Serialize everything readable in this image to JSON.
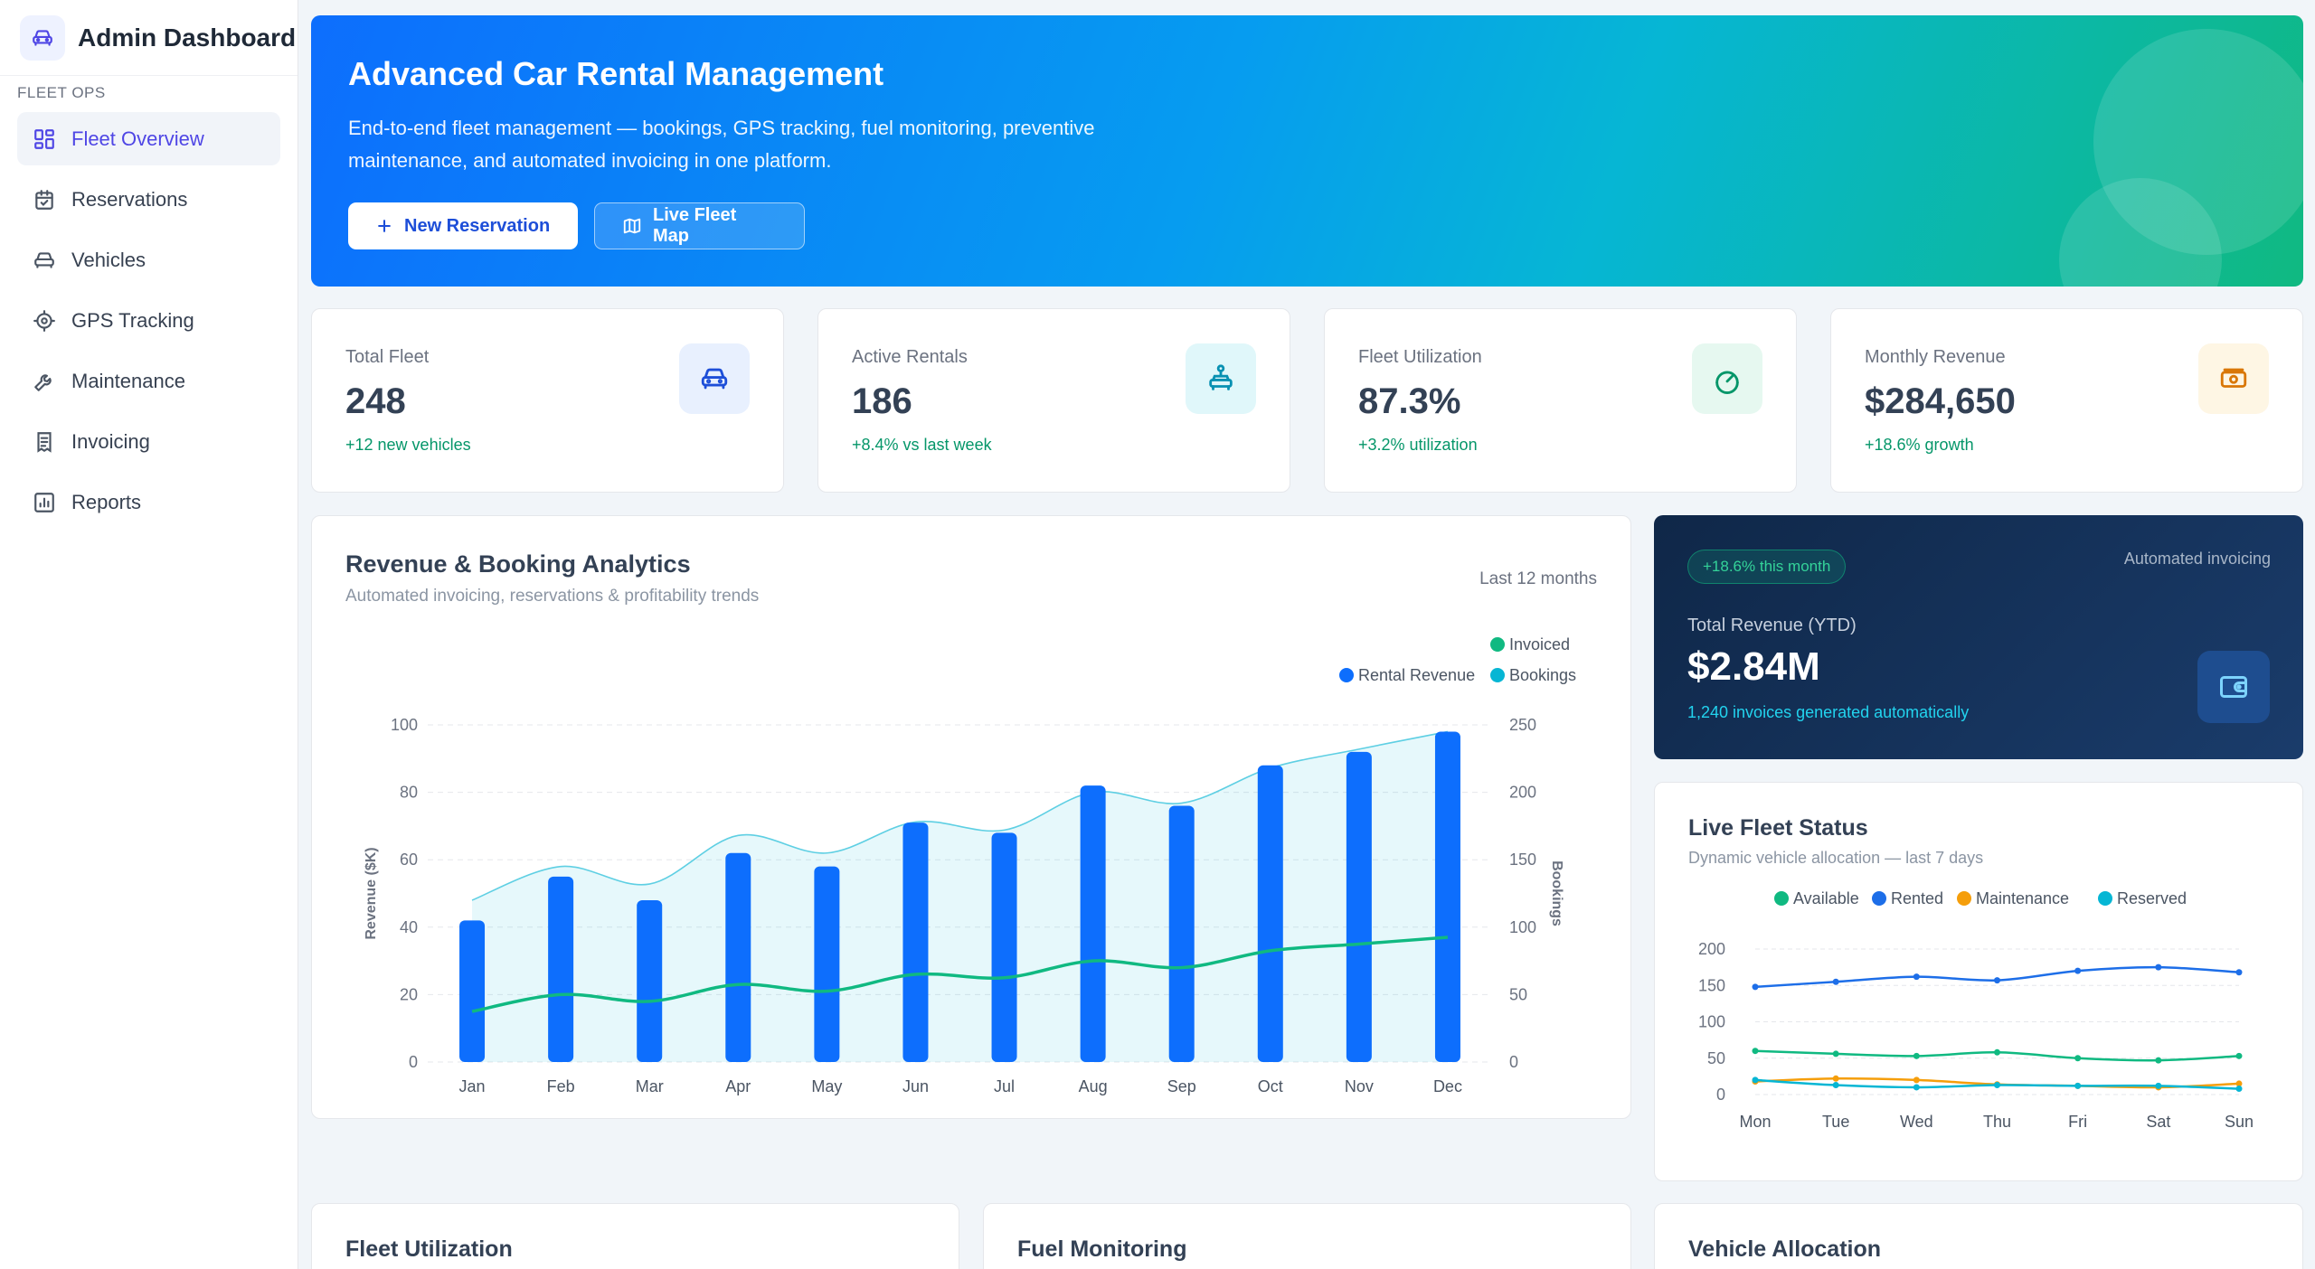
{
  "app": {
    "title": "Admin Dashboard"
  },
  "sidebar": {
    "section": "FLEET OPS",
    "items": [
      {
        "label": "Fleet Overview",
        "icon": "grid-icon",
        "active": true
      },
      {
        "label": "Reservations",
        "icon": "calendar-check-icon"
      },
      {
        "label": "Vehicles",
        "icon": "car-icon"
      },
      {
        "label": "GPS Tracking",
        "icon": "crosshair-icon"
      },
      {
        "label": "Maintenance",
        "icon": "wrench-icon"
      },
      {
        "label": "Invoicing",
        "icon": "receipt-icon"
      },
      {
        "label": "Reports",
        "icon": "bar-chart-icon"
      }
    ]
  },
  "hero": {
    "title": "Advanced Car Rental Management",
    "description": "End-to-end fleet management — bookings, GPS tracking, fuel monitoring, preventive maintenance, and automated invoicing in one platform.",
    "primary_button": "New Reservation",
    "secondary_button": "Live Fleet Map"
  },
  "stats": [
    {
      "label": "Total Fleet",
      "value": "248",
      "change": "+12 new vehicles",
      "icon": "car-icon",
      "color": "#1d4ed8",
      "bg": "#e8f0fe"
    },
    {
      "label": "Active Rentals",
      "value": "186",
      "change": "+8.4% vs last week",
      "icon": "car-key-icon",
      "color": "#0891b2",
      "bg": "#e0f7fa"
    },
    {
      "label": "Fleet Utilization",
      "value": "87.3%",
      "change": "+3.2% utilization",
      "icon": "gauge-icon",
      "color": "#059669",
      "bg": "#e6f8f0"
    },
    {
      "label": "Monthly Revenue",
      "value": "$284,650",
      "change": "+18.6% growth",
      "icon": "cash-icon",
      "color": "#d97706",
      "bg": "#fef6e4"
    }
  ],
  "analytics": {
    "title": "Revenue & Booking Analytics",
    "subtitle": "Automated invoicing, reservations & profitability trends",
    "range": "Last 12 months"
  },
  "revenue_card": {
    "badge": "+18.6% this month",
    "tag": "Automated invoicing",
    "label": "Total Revenue (YTD)",
    "value": "$2.84M",
    "note": "1,240 invoices generated automatically"
  },
  "live_fleet": {
    "title": "Live Fleet Status",
    "subtitle": "Dynamic vehicle allocation — last 7 days"
  },
  "bottom_cards": [
    "Fleet Utilization",
    "Fuel Monitoring",
    "Vehicle Allocation"
  ],
  "chart_data": [
    {
      "type": "bar",
      "categories": [
        "Jan",
        "Feb",
        "Mar",
        "Apr",
        "May",
        "Jun",
        "Jul",
        "Aug",
        "Sep",
        "Oct",
        "Nov",
        "Dec"
      ],
      "series": [
        {
          "name": "Rental Revenue",
          "type": "bar",
          "axis": "left",
          "color": "#0d6efd",
          "values": [
            42,
            55,
            48,
            62,
            58,
            71,
            68,
            82,
            76,
            88,
            92,
            98
          ]
        },
        {
          "name": "Invoiced",
          "type": "line",
          "axis": "left",
          "color": "#10b981",
          "values": [
            15,
            20,
            18,
            23,
            21,
            26,
            25,
            30,
            28,
            33,
            35,
            37
          ]
        },
        {
          "name": "Bookings",
          "type": "area",
          "axis": "right",
          "color": "#06b6d4",
          "values": [
            120,
            145,
            132,
            168,
            155,
            178,
            172,
            200,
            192,
            218,
            232,
            245
          ]
        }
      ],
      "ylabel": "Revenue ($K)",
      "y2label": "Bookings",
      "ylim": [
        0,
        100
      ],
      "y2lim": [
        0,
        250
      ],
      "yticks": [
        0,
        20,
        40,
        60,
        80,
        100
      ],
      "y2ticks": [
        0,
        50,
        100,
        150,
        200,
        250
      ],
      "grid": true,
      "legend": "top-right"
    },
    {
      "type": "line",
      "categories": [
        "Mon",
        "Tue",
        "Wed",
        "Thu",
        "Fri",
        "Sat",
        "Sun"
      ],
      "series": [
        {
          "name": "Available",
          "color": "#10b981",
          "values": [
            60,
            56,
            53,
            58,
            50,
            47,
            53
          ]
        },
        {
          "name": "Rented",
          "color": "#1d6ee8",
          "values": [
            148,
            155,
            162,
            157,
            170,
            175,
            168
          ]
        },
        {
          "name": "Maintenance",
          "color": "#f59e0b",
          "values": [
            18,
            22,
            20,
            14,
            12,
            10,
            15
          ]
        },
        {
          "name": "Reserved",
          "color": "#06b6d4",
          "values": [
            20,
            13,
            10,
            13,
            12,
            12,
            8
          ]
        }
      ],
      "ylim": [
        0,
        200
      ],
      "yticks": [
        0,
        50,
        100,
        150,
        200
      ],
      "grid": true,
      "legend": "top"
    }
  ]
}
